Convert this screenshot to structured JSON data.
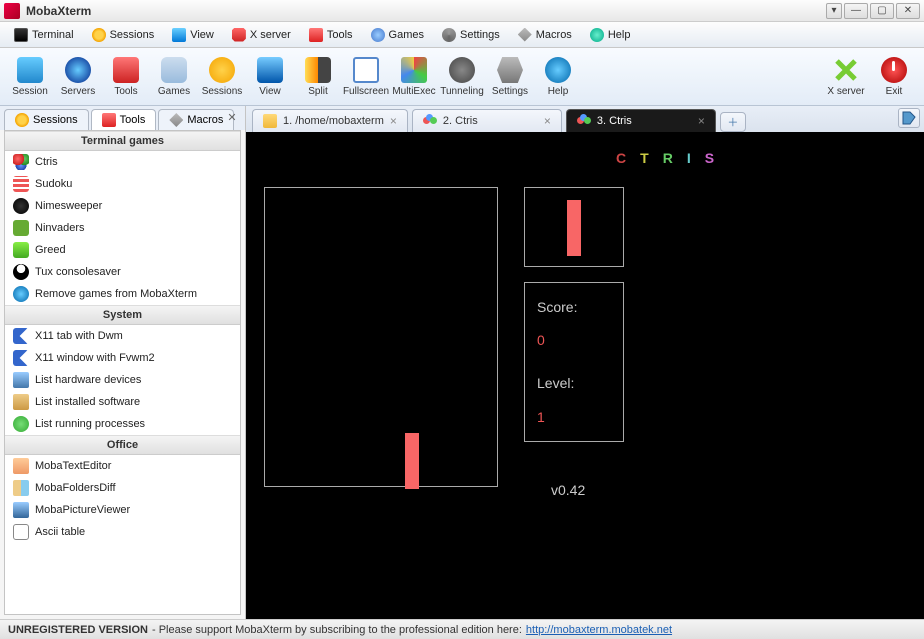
{
  "window": {
    "title": "MobaXterm"
  },
  "menubar": [
    {
      "label": "Terminal"
    },
    {
      "label": "Sessions"
    },
    {
      "label": "View"
    },
    {
      "label": "X server"
    },
    {
      "label": "Tools"
    },
    {
      "label": "Games"
    },
    {
      "label": "Settings"
    },
    {
      "label": "Macros"
    },
    {
      "label": "Help"
    }
  ],
  "toolbar": {
    "left": [
      "Session",
      "Servers",
      "Tools",
      "Games",
      "Sessions",
      "View",
      "Split",
      "Fullscreen",
      "MultiExec",
      "Tunneling",
      "Settings",
      "Help"
    ],
    "right": [
      "X server",
      "Exit"
    ]
  },
  "side_tabs": [
    {
      "label": "Sessions"
    },
    {
      "label": "Tools"
    },
    {
      "label": "Macros"
    }
  ],
  "side_active": 1,
  "side_categories": [
    {
      "title": "Terminal games",
      "items": [
        {
          "label": "Ctris",
          "icon": "balls"
        },
        {
          "label": "Sudoku",
          "icon": "grid"
        },
        {
          "label": "Nimesweeper",
          "icon": "mine"
        },
        {
          "label": "Ninvaders",
          "icon": "invader"
        },
        {
          "label": "Greed",
          "icon": "greed"
        },
        {
          "label": "Tux consolesaver",
          "icon": "tux"
        },
        {
          "label": "Remove games from MobaXterm",
          "icon": "info"
        }
      ]
    },
    {
      "title": "System",
      "items": [
        {
          "label": "X11 tab with Dwm",
          "icon": "xblue"
        },
        {
          "label": "X11 window with Fvwm2",
          "icon": "xblue"
        },
        {
          "label": "List hardware devices",
          "icon": "hw"
        },
        {
          "label": "List installed software",
          "icon": "sw"
        },
        {
          "label": "List running processes",
          "icon": "proc"
        }
      ]
    },
    {
      "title": "Office",
      "items": [
        {
          "label": "MobaTextEditor",
          "icon": "edit"
        },
        {
          "label": "MobaFoldersDiff",
          "icon": "diff"
        },
        {
          "label": "MobaPictureViewer",
          "icon": "pic"
        },
        {
          "label": "Ascii table",
          "icon": "ascii"
        }
      ]
    }
  ],
  "term_tabs": [
    {
      "label": "1. /home/mobaxterm",
      "icon": "folder"
    },
    {
      "label": "2. Ctris",
      "icon": "balls"
    },
    {
      "label": "3. Ctris",
      "icon": "balls"
    }
  ],
  "term_active": 2,
  "ctris": {
    "title": "CTRIS",
    "score_label": "Score:",
    "score_value": "0",
    "level_label": "Level:",
    "level_value": "1",
    "version": "v0.42"
  },
  "status": {
    "unreg": "UNREGISTERED VERSION",
    "msg": " - Please support MobaXterm by subscribing to the professional edition here: ",
    "url": "http://mobaxterm.mobatek.net"
  }
}
